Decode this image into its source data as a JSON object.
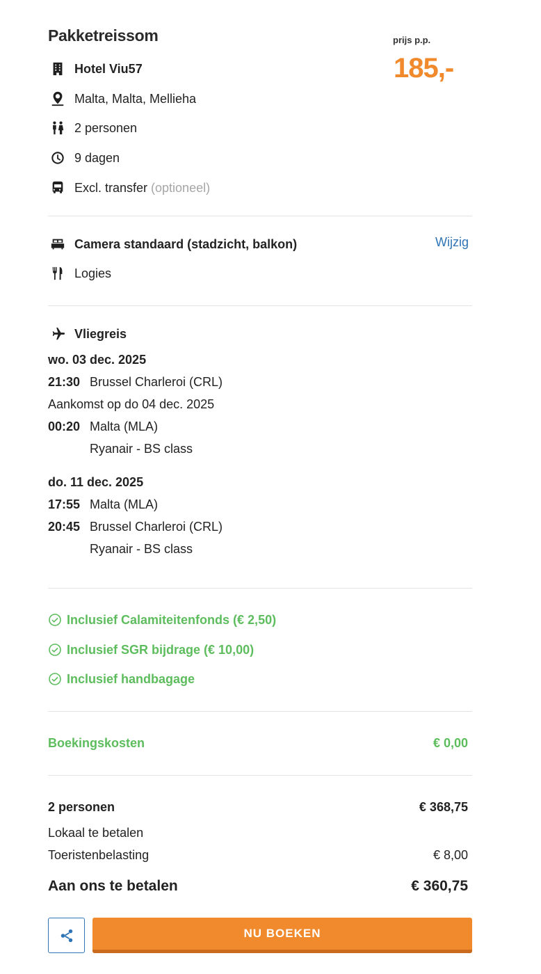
{
  "header": {
    "title": "Pakketreissom",
    "price_label": "prijs p.p.",
    "price_value": "185,-"
  },
  "package": {
    "hotel": "Hotel Viu57",
    "location": "Malta, Malta, Mellieha",
    "persons": "2 personen",
    "duration": "9 dagen",
    "transfer": "Excl. transfer",
    "transfer_note": "(optioneel)"
  },
  "room": {
    "type": "Camera standaard (stadzicht, balkon)",
    "change_label": "Wijzig",
    "board": "Logies"
  },
  "flight": {
    "heading": "Vliegreis",
    "outbound": {
      "date": "wo. 03 dec. 2025",
      "dep_time": "21:30",
      "dep_airport": "Brussel Charleroi (CRL)",
      "arrival_note": "Aankomst op do 04 dec. 2025",
      "arr_time": "00:20",
      "arr_airport": "Malta (MLA)",
      "carrier": "Ryanair - BS class"
    },
    "return": {
      "date": "do. 11 dec. 2025",
      "dep_time": "17:55",
      "dep_airport": "Malta (MLA)",
      "arr_time": "20:45",
      "arr_airport": "Brussel Charleroi (CRL)",
      "carrier": "Ryanair - BS class"
    }
  },
  "inclusions": [
    "Inclusief Calamiteitenfonds (€ 2,50)",
    "Inclusief SGR bijdrage (€ 10,00)",
    "Inclusief handbagage"
  ],
  "costs": {
    "booking_label": "Boekingskosten",
    "booking_value": "€ 0,00",
    "persons_label": "2 personen",
    "persons_value": "€ 368,75",
    "local_label": "Lokaal te betalen",
    "tax_label": "Toeristenbelasting",
    "tax_value": "€ 8,00",
    "total_label": "Aan ons te betalen",
    "total_value": "€ 360,75"
  },
  "actions": {
    "book_label": "NU BOEKEN"
  },
  "colors": {
    "accent_orange": "#f08a2c",
    "link_blue": "#2f74b5",
    "success_green": "#5dbd5d"
  },
  "icons": {
    "hotel": "building-icon",
    "location": "map-pin-icon",
    "persons": "people-icon",
    "duration": "timer-icon",
    "transfer": "bus-icon",
    "room": "bed-icon",
    "board": "cutlery-icon",
    "flight": "airplane-icon",
    "inclusion": "check-circle-icon",
    "share": "share-icon"
  }
}
